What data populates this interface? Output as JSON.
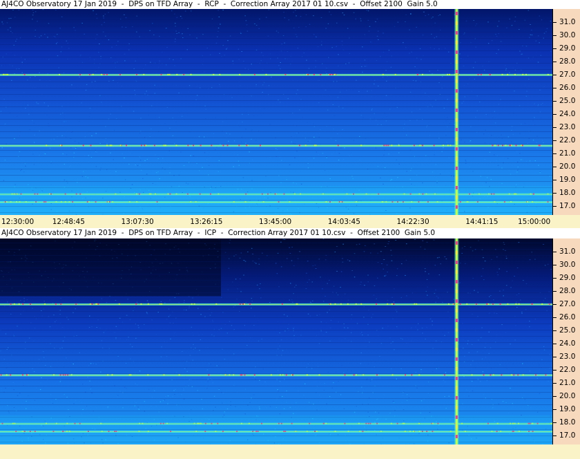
{
  "chart_data": [
    {
      "type": "heatmap",
      "title": "AJ4CO Observatory 17 Jan 2019  -  DPS on TFD Array  -  RCP  -  Correction Array 2017 01 10.csv  -  Offset 2100  Gain 5.0",
      "x_tick_labels": [
        "12:30:00",
        "12:48:45",
        "13:07:30",
        "13:26:15",
        "13:45:00",
        "14:03:45",
        "14:22:30",
        "14:41:15",
        "15:00:00"
      ],
      "y_tick_labels": [
        "31.0",
        "30.0",
        "29.0",
        "28.0",
        "27.0",
        "26.0",
        "25.0",
        "24.0",
        "23.0",
        "22.0",
        "21.0",
        "20.0",
        "19.0",
        "18.0",
        "17.0"
      ],
      "y_ticks": [
        31.0,
        30.0,
        29.0,
        28.0,
        27.0,
        26.0,
        25.0,
        24.0,
        23.0,
        22.0,
        21.0,
        20.0,
        19.0,
        18.0,
        17.0
      ],
      "ylim": [
        16.3,
        32.0
      ],
      "xlim": [
        "12:30:00",
        "15:00:00"
      ],
      "colormap": [
        "#000a3c",
        "#0a2aa0",
        "#1456d2",
        "#1e8cf0",
        "#1ec8ff",
        "#50ffd2",
        "#c8ff3c",
        "#ffe628",
        "#ff3c78"
      ],
      "features": [
        {
          "kind": "vertical-burst",
          "time": "14:34:00"
        },
        {
          "kind": "horizontal-band",
          "frequency": 27.0
        },
        {
          "kind": "horizontal-band",
          "frequency": 21.6
        },
        {
          "kind": "horizontal-band",
          "frequency": 17.9
        },
        {
          "kind": "horizontal-band",
          "frequency": 17.3
        }
      ]
    },
    {
      "type": "heatmap",
      "title": "AJ4CO Observatory 17 Jan 2019  -  DPS on TFD Array  -  ICP  -  Correction Array 2017 01 10.csv  -  Offset 2100  Gain 5.0",
      "x_tick_labels": [],
      "y_tick_labels": [
        "31.0",
        "30.0",
        "29.0",
        "28.0",
        "27.0",
        "26.0",
        "25.0",
        "24.0",
        "23.0",
        "22.0",
        "21.0",
        "20.0",
        "19.0",
        "18.0",
        "17.0"
      ],
      "y_ticks": [
        31.0,
        30.0,
        29.0,
        28.0,
        27.0,
        26.0,
        25.0,
        24.0,
        23.0,
        22.0,
        21.0,
        20.0,
        19.0,
        18.0,
        17.0
      ],
      "ylim": [
        16.3,
        32.0
      ],
      "xlim": [
        "12:30:00",
        "15:00:00"
      ],
      "colormap": [
        "#000a3c",
        "#0a2aa0",
        "#1456d2",
        "#1e8cf0",
        "#1ec8ff",
        "#50ffd2",
        "#c8ff3c",
        "#ffe628",
        "#ff3c78"
      ],
      "features": [
        {
          "kind": "vertical-burst",
          "time": "14:34:00"
        },
        {
          "kind": "horizontal-band",
          "frequency": 27.0
        },
        {
          "kind": "horizontal-band",
          "frequency": 21.6
        },
        {
          "kind": "horizontal-band",
          "frequency": 17.9
        },
        {
          "kind": "horizontal-band",
          "frequency": 17.3
        }
      ]
    }
  ]
}
